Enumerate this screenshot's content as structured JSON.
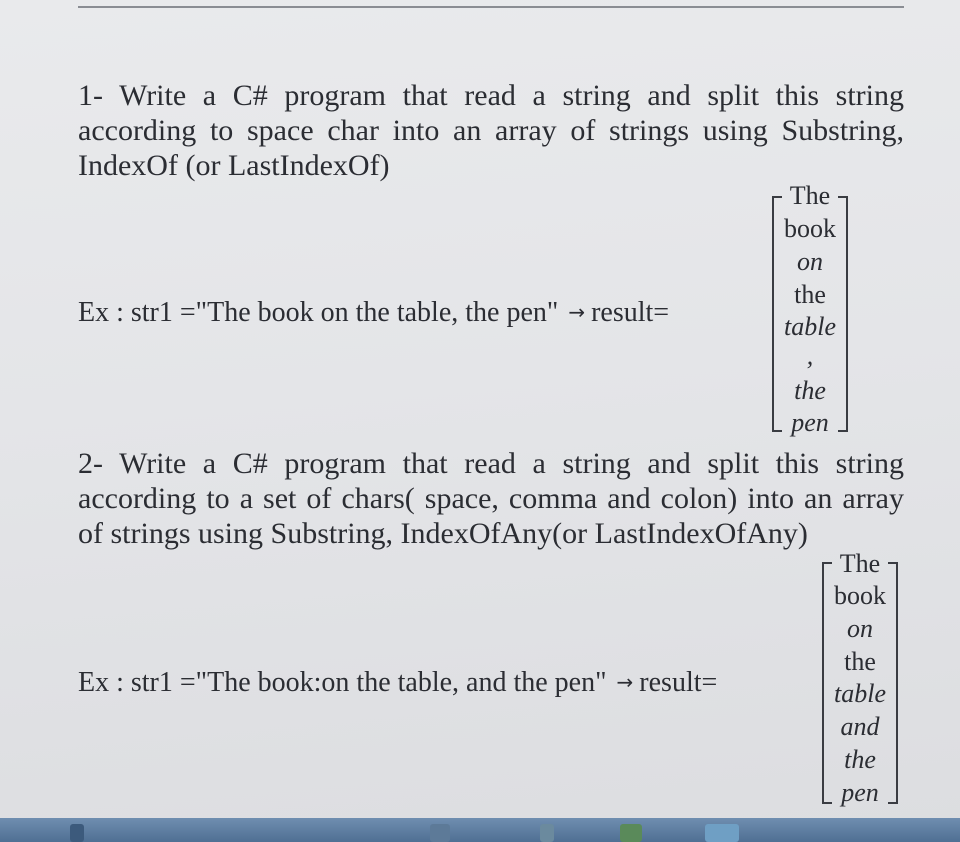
{
  "question1": {
    "text": "1- Write a C# program that read a string and split this string according to space char into an array of strings using Substring, IndexOf (or LastIndexOf)",
    "example_prefix": "Ex : str1 =\"The book on the table, the pen\"",
    "arrow": "→",
    "result_label": "result=",
    "result_items": [
      {
        "text": "The",
        "italic": false
      },
      {
        "text": "book",
        "italic": false
      },
      {
        "text": "on",
        "italic": true
      },
      {
        "text": "the",
        "italic": false
      },
      {
        "text": "table",
        "italic": true
      },
      {
        "text": ",",
        "italic": true
      },
      {
        "text": "the",
        "italic": true
      },
      {
        "text": "pen",
        "italic": true
      }
    ]
  },
  "question2": {
    "text": "2- Write a C# program that read a string and split this string according to a set of chars( space, comma and colon) into an array of strings using Substring, IndexOfAny(or LastIndexOfAny)",
    "example_prefix": "Ex : str1 =\"The book:on the table, and the pen\"",
    "arrow": "→",
    "result_label": "result=",
    "result_items": [
      {
        "text": "The",
        "italic": false
      },
      {
        "text": "book",
        "italic": false
      },
      {
        "text": "on",
        "italic": true
      },
      {
        "text": "the",
        "italic": false
      },
      {
        "text": "table",
        "italic": true
      },
      {
        "text": "and",
        "italic": true
      },
      {
        "text": "the",
        "italic": true
      },
      {
        "text": "pen",
        "italic": true
      }
    ]
  }
}
